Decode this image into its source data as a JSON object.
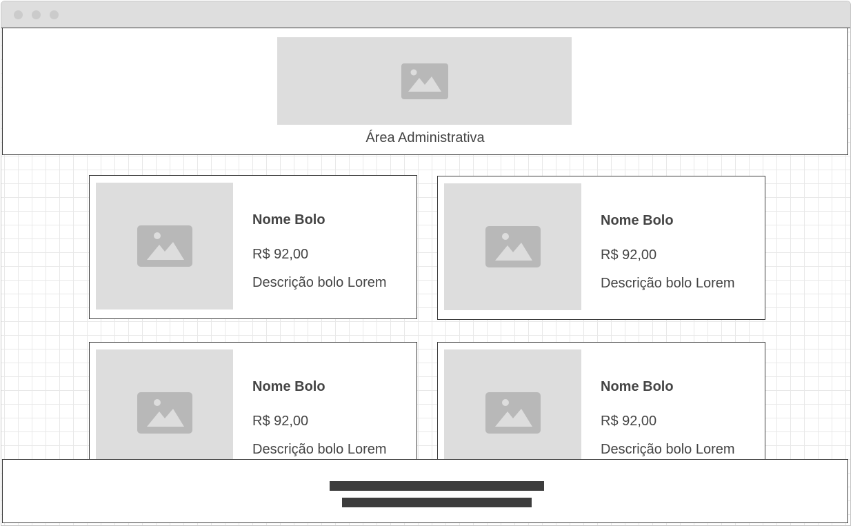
{
  "header": {
    "title": "Área Administrativa",
    "image_icon": "image-placeholder-icon"
  },
  "products": [
    {
      "name": "Nome Bolo",
      "price": "R$ 92,00",
      "description": "Descrição bolo Lorem"
    },
    {
      "name": "Nome Bolo",
      "price": "R$ 92,00",
      "description": "Descrição bolo Lorem"
    },
    {
      "name": "Nome Bolo",
      "price": "R$ 92,00",
      "description": "Descrição bolo Lorem"
    },
    {
      "name": "Nome Bolo",
      "price": "R$ 92,00",
      "description": "Descrição bolo Lorem"
    }
  ],
  "colors": {
    "placeholder_bg": "#dddddd",
    "placeholder_icon": "#b8b8b8",
    "text": "#444444",
    "border": "#3a3a3a",
    "footer_bar": "#3d3d3d"
  }
}
